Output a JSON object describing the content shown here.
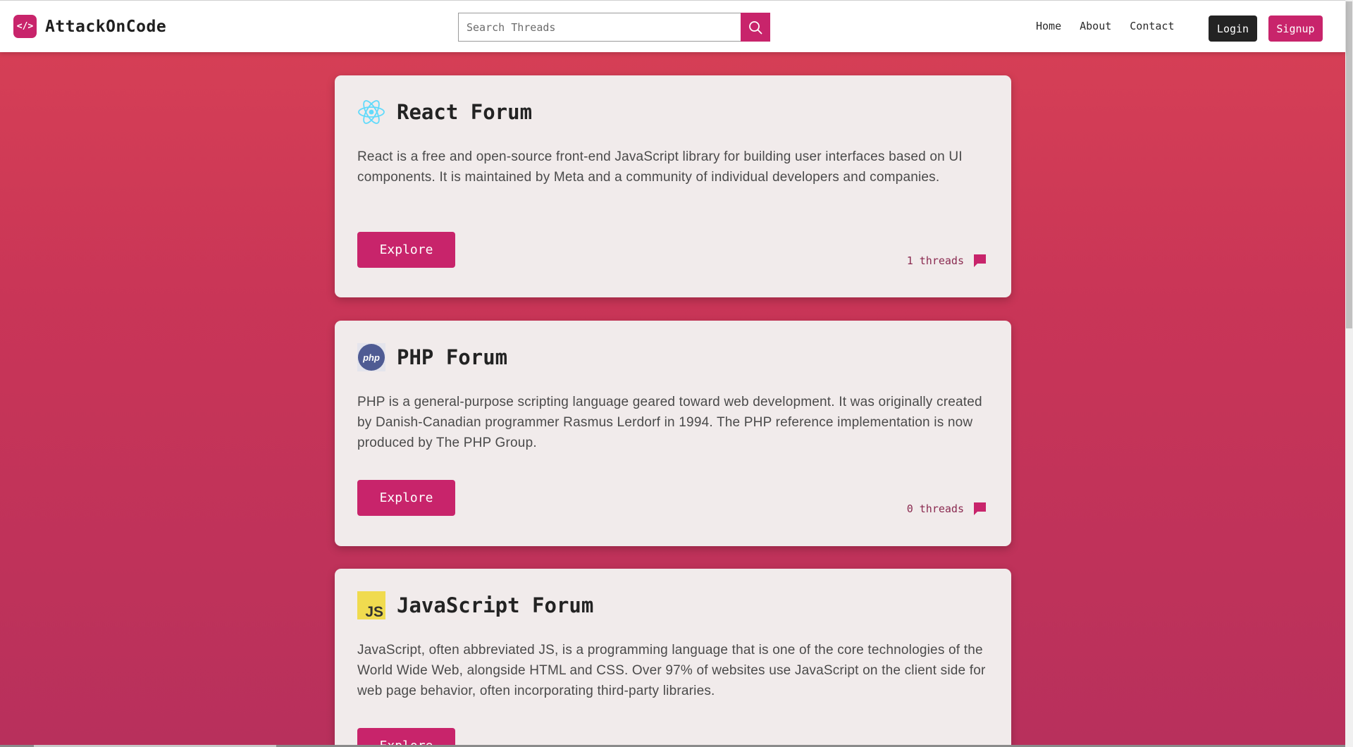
{
  "brand": {
    "name": "AttackOnCode",
    "logo_glyph": "</>"
  },
  "search": {
    "placeholder": "Search Threads"
  },
  "nav": {
    "links": [
      "Home",
      "About",
      "Contact"
    ],
    "login_label": "Login",
    "signup_label": "Signup"
  },
  "colors": {
    "accent": "#c8246b",
    "background_top": "#d84155",
    "background_bottom": "#b8305c",
    "card": "#f1ebeb",
    "login_button": "#232323"
  },
  "forums": [
    {
      "title": "React Forum",
      "icon": "react-icon",
      "description": "React is a free and open-source front-end JavaScript library for building user interfaces based on UI components. It is maintained by Meta and a community of individual developers and companies.",
      "explore_label": "Explore",
      "threads_label": "1 threads"
    },
    {
      "title": "PHP Forum",
      "icon": "php-icon",
      "icon_text": "php",
      "description": "PHP is a general-purpose scripting language geared toward web development. It was originally created by Danish-Canadian programmer Rasmus Lerdorf in 1994. The PHP reference implementation is now produced by The PHP Group.",
      "explore_label": "Explore",
      "threads_label": "0 threads"
    },
    {
      "title": "JavaScript Forum",
      "icon": "javascript-icon",
      "icon_text": "JS",
      "description": "JavaScript, often abbreviated JS, is a programming language that is one of the core technologies of the World Wide Web, alongside HTML and CSS. Over 97% of websites use JavaScript on the client side for web page behavior, often incorporating third-party libraries.",
      "explore_label": "Explore"
    }
  ]
}
